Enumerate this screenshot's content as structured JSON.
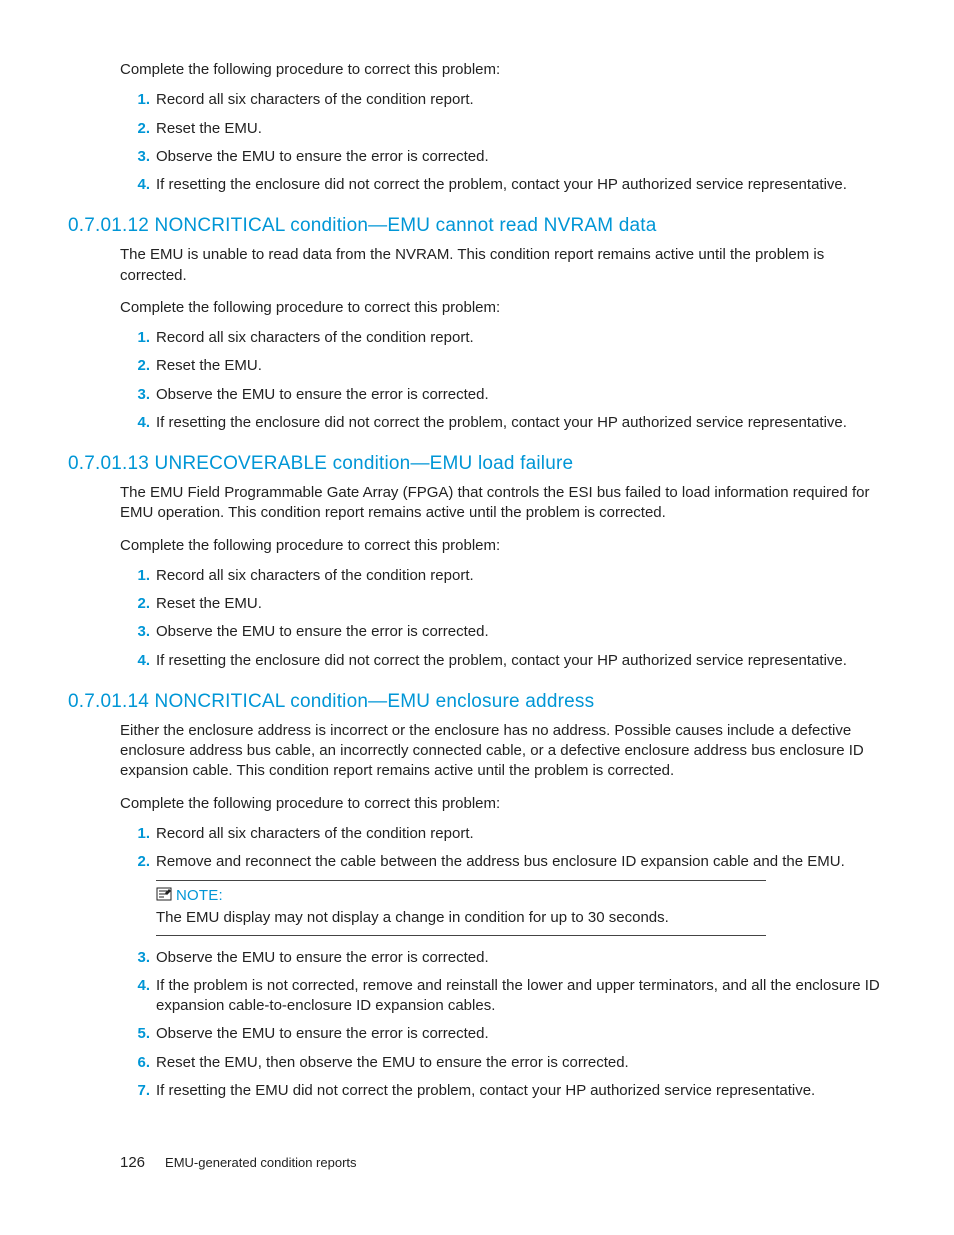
{
  "sec0": {
    "proc": "Complete the following procedure to correct this problem:",
    "steps": [
      "Record all six characters of the condition report.",
      "Reset the EMU.",
      "Observe the EMU to ensure the error is corrected.",
      "If resetting the enclosure did not correct the problem, contact your HP authorized service representative."
    ]
  },
  "sec1": {
    "heading": "0.7.01.12 NONCRITICAL condition—EMU cannot read NVRAM data",
    "intro": "The EMU is unable to read data from the NVRAM. This condition report remains active until the problem is corrected.",
    "proc": "Complete the following procedure to correct this problem:",
    "steps": [
      "Record all six characters of the condition report.",
      "Reset the EMU.",
      "Observe the EMU to ensure the error is corrected.",
      "If resetting the enclosure did not correct the problem, contact your HP authorized service representative."
    ]
  },
  "sec2": {
    "heading": "0.7.01.13 UNRECOVERABLE condition—EMU load failure",
    "intro": "The EMU Field Programmable Gate Array (FPGA) that controls the ESI bus failed to load information required for EMU operation. This condition report remains active until the problem is corrected.",
    "proc": "Complete the following procedure to correct this problem:",
    "steps": [
      "Record all six characters of the condition report.",
      "Reset the EMU.",
      "Observe the EMU to ensure the error is corrected.",
      "If resetting the enclosure did not correct the problem, contact your HP authorized service representative."
    ]
  },
  "sec3": {
    "heading": "0.7.01.14 NONCRITICAL condition—EMU enclosure address",
    "intro": "Either the enclosure address is incorrect or the enclosure has no address. Possible causes include a defective enclosure address bus cable, an incorrectly connected cable, or a defective enclosure address bus enclosure ID expansion cable. This condition report remains active until the problem is corrected.",
    "proc": "Complete the following procedure to correct this problem:",
    "stepsA": [
      "Record all six characters of the condition report.",
      "Remove and reconnect the cable between the address bus enclosure ID expansion cable and the EMU."
    ],
    "note_label": "NOTE:",
    "note_text": "The EMU display may not display a change in condition for up to 30 seconds.",
    "stepsB": [
      "Observe the EMU to ensure the error is corrected.",
      "If the problem is not corrected, remove and reinstall the lower and upper terminators, and all the enclosure ID expansion cable-to-enclosure ID expansion cables.",
      "Observe the EMU to ensure the error is corrected.",
      "Reset the EMU, then observe the EMU to ensure the error is corrected.",
      "If resetting the EMU did not correct the problem, contact your HP authorized service representative."
    ]
  },
  "footer": {
    "page": "126",
    "title": "EMU-generated condition reports"
  }
}
